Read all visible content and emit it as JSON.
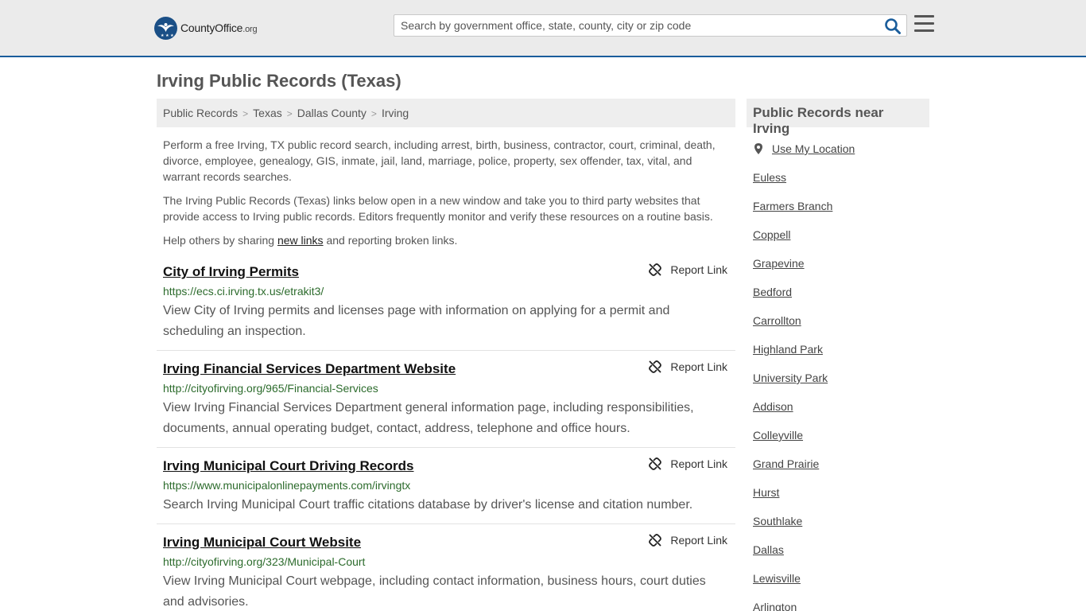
{
  "header": {
    "logo_text": "CountyOffice",
    "logo_org": ".org",
    "search_placeholder": "Search by government office, state, county, city or zip code"
  },
  "page_title": "Irving Public Records (Texas)",
  "breadcrumb": [
    "Public Records",
    "Texas",
    "Dallas County",
    "Irving"
  ],
  "intro": {
    "p1": "Perform a free Irving, TX public record search, including arrest, birth, business, contractor, court, criminal, death, divorce, employee, genealogy, GIS, inmate, jail, land, marriage, police, property, sex offender, tax, vital, and warrant records searches.",
    "p2": "The Irving Public Records (Texas) links below open in a new window and take you to third party websites that provide access to Irving public records. Editors frequently monitor and verify these resources on a routine basis.",
    "p3_before": "Help others by sharing ",
    "p3_link": "new links",
    "p3_after": " and reporting broken links."
  },
  "report_label": "Report Link",
  "links": [
    {
      "title": "City of Irving Permits",
      "url": "https://ecs.ci.irving.tx.us/etrakit3/",
      "desc": "View City of Irving permits and licenses page with information on applying for a permit and scheduling an inspection."
    },
    {
      "title": "Irving Financial Services Department Website",
      "url": "http://cityofirving.org/965/Financial-Services",
      "desc": "View Irving Financial Services Department general information page, including responsibilities, documents, annual operating budget, contact, address, telephone and office hours."
    },
    {
      "title": "Irving Municipal Court Driving Records",
      "url": "https://www.municipalonlinepayments.com/irvingtx",
      "desc": "Search Irving Municipal Court traffic citations database by driver's license and citation number."
    },
    {
      "title": "Irving Municipal Court Website",
      "url": "http://cityofirving.org/323/Municipal-Court",
      "desc": "View Irving Municipal Court webpage, including contact information, business hours, court duties and advisories."
    }
  ],
  "sidebar": {
    "title": "Public Records near Irving",
    "use_location": "Use My Location",
    "cities": [
      "Euless",
      "Farmers Branch",
      "Coppell",
      "Grapevine",
      "Bedford",
      "Carrollton",
      "Highland Park",
      "University Park",
      "Addison",
      "Colleyville",
      "Grand Prairie",
      "Hurst",
      "Southlake",
      "Dallas",
      "Lewisville",
      "Arlington"
    ]
  },
  "colors": {
    "brand_blue": "#1a4f86",
    "url_green": "#2c6b2c",
    "header_bg": "#ebebeb"
  }
}
